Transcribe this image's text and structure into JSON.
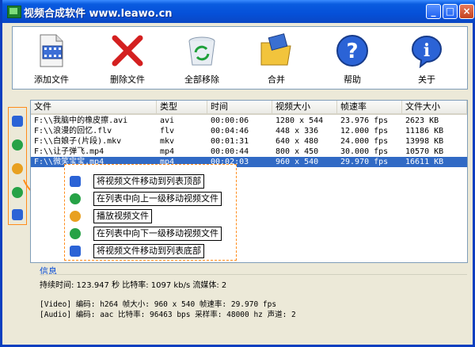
{
  "window": {
    "title": "视频合成软件 www.leawo.cn",
    "buttons": {
      "minimize": "_",
      "maximize": "□",
      "close": "×"
    }
  },
  "toolbar": {
    "items": [
      {
        "label": "添加文件",
        "icon": "add-file-icon"
      },
      {
        "label": "删除文件",
        "icon": "delete-file-icon"
      },
      {
        "label": "全部移除",
        "icon": "remove-all-icon"
      },
      {
        "label": "合并",
        "icon": "merge-icon"
      },
      {
        "label": "帮助",
        "icon": "help-icon"
      },
      {
        "label": "关于",
        "icon": "about-icon"
      }
    ]
  },
  "list": {
    "columns": [
      "文件",
      "类型",
      "时间",
      "视频大小",
      "帧速率",
      "文件大小"
    ],
    "rows": [
      {
        "file": "F:\\\\我脑中的橡皮擦.avi",
        "type": "avi",
        "time": "00:00:06",
        "size": "1280 x 544",
        "fps": "23.976 fps",
        "filesize": "2623 KB"
      },
      {
        "file": "F:\\\\浪漫的回忆.flv",
        "type": "flv",
        "time": "00:04:46",
        "size": "448 x 336",
        "fps": "12.000 fps",
        "filesize": "11186 KB"
      },
      {
        "file": "F:\\\\白娘子(片段).mkv",
        "type": "mkv",
        "time": "00:01:31",
        "size": "640 x 480",
        "fps": "24.000 fps",
        "filesize": "13998 KB"
      },
      {
        "file": "F:\\\\让子弹飞.mp4",
        "type": "mp4",
        "time": "00:00:44",
        "size": "800 x 450",
        "fps": "30.000 fps",
        "filesize": "10570 KB"
      },
      {
        "file": "F:\\\\微笑宝宝.mp4",
        "type": "mp4",
        "time": "00:02:03",
        "size": "960 x 540",
        "fps": "29.970 fps",
        "filesize": "16611 KB"
      }
    ]
  },
  "legend": {
    "items": [
      "将视频文件移动到列表顶部",
      "在列表中向上一级移动视频文件",
      "播放视频文件",
      "在列表中向下一级移动视频文件",
      "将视频文件移动到列表底部"
    ]
  },
  "info": {
    "label": "信息",
    "summary": "持续时间: 123.947 秒  比特率: 1097 kb/s  流媒体: 2",
    "video": "[Video]  编码: h264  帧大小: 960 x 540  帧速率: 29.970 fps",
    "audio": "[Audio]  编码: aac  比特率: 96463 bps  采样率: 48000 hz  声道: 2"
  },
  "colors": {
    "titlebar": "#0550d8",
    "selection": "#316ac5",
    "accent_orange": "#ff8c1a",
    "info_blue": "#0046d5"
  }
}
